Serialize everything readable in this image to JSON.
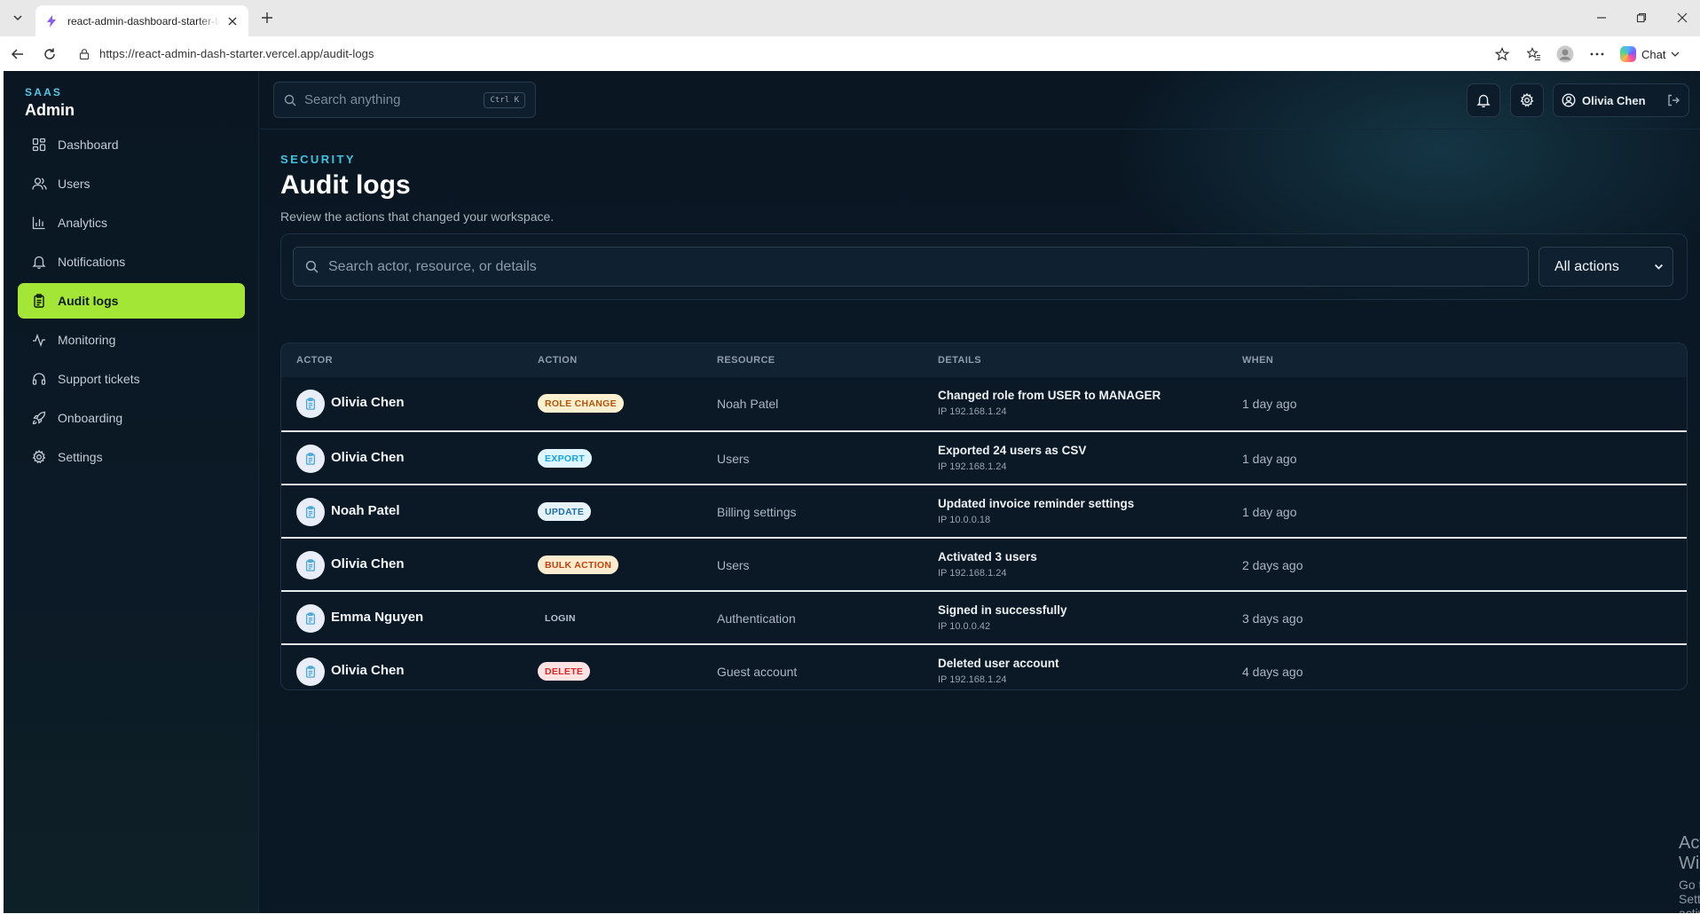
{
  "browser": {
    "tab_title": "react-admin-dashboard-starter-te",
    "url": "https://react-admin-dash-starter.vercel.app/audit-logs",
    "chat_label": "Chat"
  },
  "brand": {
    "kicker": "SAAS",
    "title": "Admin"
  },
  "sidebar": {
    "items": [
      {
        "label": "Dashboard",
        "icon": "grid-icon"
      },
      {
        "label": "Users",
        "icon": "users-icon"
      },
      {
        "label": "Analytics",
        "icon": "bar-chart-icon"
      },
      {
        "label": "Notifications",
        "icon": "bell-icon"
      },
      {
        "label": "Audit logs",
        "icon": "clipboard-icon",
        "active": true
      },
      {
        "label": "Monitoring",
        "icon": "activity-icon"
      },
      {
        "label": "Support tickets",
        "icon": "headset-icon"
      },
      {
        "label": "Onboarding",
        "icon": "rocket-icon"
      },
      {
        "label": "Settings",
        "icon": "gear-icon"
      }
    ]
  },
  "topbar": {
    "search_placeholder": "Search anything",
    "shortcut": "Ctrl K",
    "user_name": "Olivia Chen"
  },
  "page": {
    "kicker": "SECURITY",
    "title": "Audit logs",
    "subtitle": "Review the actions that changed your workspace."
  },
  "filters": {
    "search_placeholder": "Search actor, resource, or details",
    "action_select": "All actions"
  },
  "table": {
    "headers": {
      "actor": "ACTOR",
      "action": "ACTION",
      "resource": "RESOURCE",
      "details": "DETAILS",
      "when": "WHEN"
    },
    "rows": [
      {
        "actor": "Olivia Chen",
        "action": "ROLE CHANGE",
        "resource": "Noah Patel",
        "details": "Changed role from USER to MANAGER",
        "ip": "IP 192.168.1.24",
        "when": "1 day ago"
      },
      {
        "actor": "Olivia Chen",
        "action": "EXPORT",
        "resource": "Users",
        "details": "Exported 24 users as CSV",
        "ip": "IP 192.168.1.24",
        "when": "1 day ago"
      },
      {
        "actor": "Noah Patel",
        "action": "UPDATE",
        "resource": "Billing settings",
        "details": "Updated invoice reminder settings",
        "ip": "IP 10.0.0.18",
        "when": "1 day ago"
      },
      {
        "actor": "Olivia Chen",
        "action": "BULK ACTION",
        "resource": "Users",
        "details": "Activated 3 users",
        "ip": "IP 192.168.1.24",
        "when": "2 days ago"
      },
      {
        "actor": "Emma Nguyen",
        "action": "LOGIN",
        "resource": "Authentication",
        "details": "Signed in successfully",
        "ip": "IP 10.0.0.42",
        "when": "3 days ago"
      },
      {
        "actor": "Olivia Chen",
        "action": "DELETE",
        "resource": "Guest account",
        "details": "Deleted user account",
        "ip": "IP 192.168.1.24",
        "when": "4 days ago"
      }
    ]
  },
  "watermark": {
    "line1": "Activate Windows",
    "line2": "Go to Settings to activate Windows."
  },
  "colors": {
    "accent": "#a3e635",
    "background": "#0a1723",
    "kicker": "#3fc4e0"
  }
}
